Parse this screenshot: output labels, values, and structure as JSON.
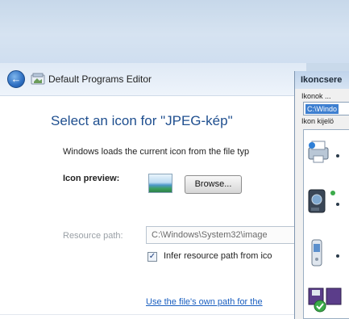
{
  "editor": {
    "title": "Default Programs Editor",
    "heading": "Select an icon for \"JPEG-kép\"",
    "description": "Windows loads the current icon from the file typ",
    "preview_label": "Icon preview:",
    "browse_label": "Browse...",
    "resource_label": "Resource path:",
    "resource_value": "C:\\Windows\\System32\\image",
    "infer_checked": true,
    "infer_label": "Infer resource path from ico",
    "own_path_link": "Use the file's own path for the"
  },
  "picker": {
    "title": "Ikoncsere",
    "label1": "Ikonok ...",
    "field_value": "C:\\Windo",
    "label2": "Ikon kijelö",
    "icons": [
      "printer-icon",
      "camera-icon",
      "phone-icon",
      "disk-icon"
    ]
  }
}
